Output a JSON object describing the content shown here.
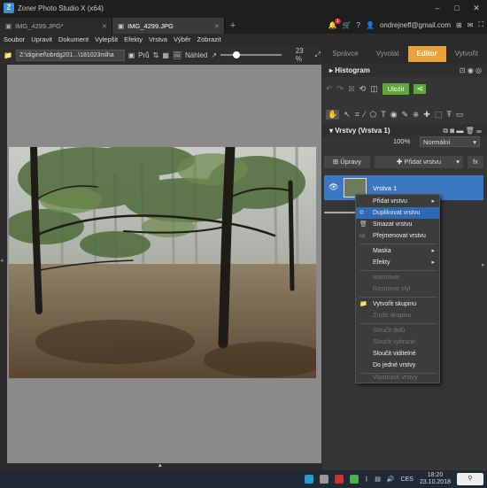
{
  "window": {
    "title": "Zoner Photo Studio X (x64)",
    "minimize": "–",
    "maximize": "□",
    "close": "✕"
  },
  "tabs": [
    {
      "label": "IMG_4299.JPG*"
    },
    {
      "label": "IMG_4299.JPG"
    }
  ],
  "account": {
    "notifications": "1",
    "email": "ondrejneff@gmail.com"
  },
  "menu": [
    "Soubor",
    "Upravit",
    "Dokument",
    "Vylepšit",
    "Efekty",
    "Vrstva",
    "Výběr",
    "Zobrazit"
  ],
  "modes": [
    "Správce",
    "Vyvolat",
    "Editor",
    "Vytvořit"
  ],
  "toolbar": {
    "path": "Z:\\diginef\\obrdg201...\\181023mlha",
    "pruchod": "Prů",
    "nahled": "Náhled",
    "zoom": "23 %"
  },
  "histogram": {
    "title": "Histogram"
  },
  "edit": {
    "save": "Uložit"
  },
  "layers": {
    "title": "Vrstvy (Vrstva 1)",
    "opacity": "100%",
    "blend": "Normální",
    "adjust": "Úpravy",
    "add": "Přidat vrstvu",
    "fx": "fx",
    "layer_name": "Vrstva 1"
  },
  "context_menu": [
    {
      "label": "Přidat vrstvu",
      "submenu": true
    },
    {
      "label": "Duplikovat vrstvu",
      "highlight": true
    },
    {
      "label": "Smazat vrstvu"
    },
    {
      "label": "Přejmenovat vrstvu"
    },
    {
      "label": "Maska",
      "submenu": true
    },
    {
      "label": "Efekty",
      "submenu": true
    },
    {
      "label": "Rastrovat",
      "disabled": true
    },
    {
      "label": "Rastrovat styl",
      "disabled": true
    },
    {
      "label": "Vytvořit skupinu"
    },
    {
      "label": "Zrušit skupinu",
      "disabled": true
    },
    {
      "label": "Sloučit dolů",
      "disabled": true
    },
    {
      "label": "Sloučit vybrané",
      "disabled": true
    },
    {
      "label": "Sloučit viditelné"
    },
    {
      "label": "Do jedné vrstvy"
    },
    {
      "label": "Vlastnosti vrstvy",
      "disabled": true
    }
  ],
  "taskbar": {
    "lang": "CES",
    "time": "18:20",
    "date": "23.10.2018"
  },
  "colors": {
    "accent": "#e8a23a",
    "selection": "#3b78c2",
    "save": "#5fa73b"
  }
}
